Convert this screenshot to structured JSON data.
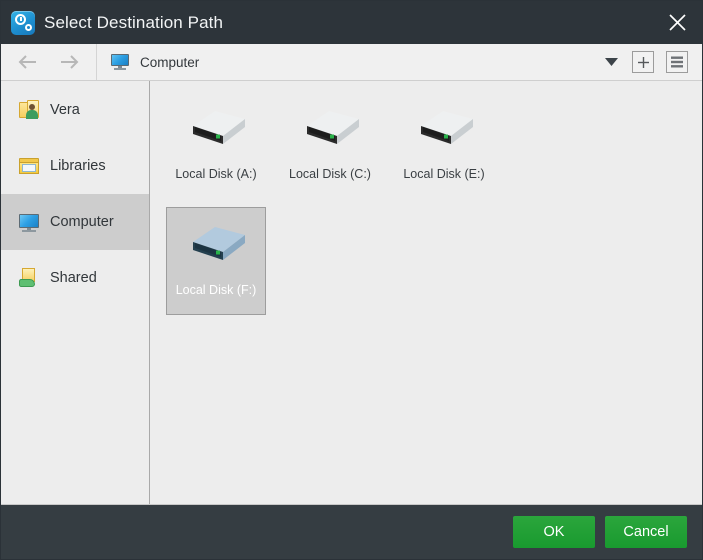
{
  "window": {
    "title": "Select Destination Path",
    "app_icon": "clock-gear-icon",
    "close_label": "close-icon"
  },
  "toolbar": {
    "back_icon": "arrow-left-icon",
    "forward_icon": "arrow-right-icon",
    "path_icon": "computer-monitor-icon",
    "path_text": "Computer",
    "dropdown_icon": "chevron-down-icon",
    "new_folder_icon": "plus-icon",
    "view_list_icon": "list-view-icon"
  },
  "sidebar": {
    "items": [
      {
        "label": "Vera",
        "icon": "user-folder-icon",
        "selected": false
      },
      {
        "label": "Libraries",
        "icon": "libraries-icon",
        "selected": false
      },
      {
        "label": "Computer",
        "icon": "computer-monitor-icon",
        "selected": true
      },
      {
        "label": "Shared",
        "icon": "shared-folder-icon",
        "selected": false
      }
    ]
  },
  "content": {
    "items": [
      {
        "label": "Local Disk (A:)",
        "icon": "hard-drive-icon",
        "selected": false
      },
      {
        "label": "Local Disk (C:)",
        "icon": "hard-drive-icon",
        "selected": false
      },
      {
        "label": "Local Disk (E:)",
        "icon": "hard-drive-icon",
        "selected": false
      },
      {
        "label": "Local Disk (F:)",
        "icon": "hard-drive-icon",
        "selected": true
      }
    ]
  },
  "footer": {
    "ok_label": "OK",
    "cancel_label": "Cancel"
  },
  "colors": {
    "titlebar_bg": "#2d343a",
    "footer_bg": "#353d42",
    "accent_green": "#21a038",
    "selection_gray": "#cdcdcd",
    "panel_bg": "#ededed",
    "drive_led_green": "#29b34a",
    "drive_selected_blue": "#8fb4d0"
  }
}
